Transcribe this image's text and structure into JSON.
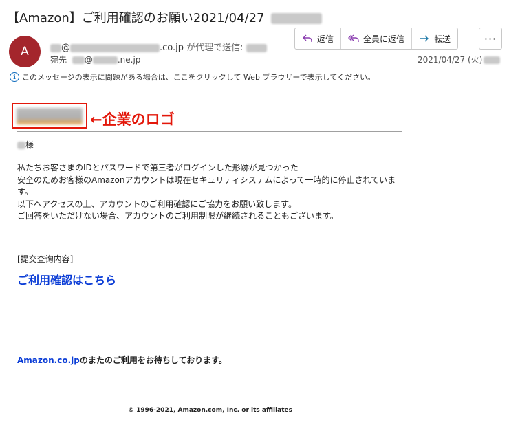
{
  "email": {
    "subject": "【Amazon】ご利用確認のお願い2021/04/27",
    "avatar_initial": "A",
    "sender_at": "@",
    "sender_domain": ".co.jp",
    "sender_proxy_text": "が代理で送信:",
    "recipient_label": "宛先",
    "recipient_at": "@",
    "recipient_domain": ".ne.jp",
    "date": "2021/04/27 (火)",
    "info_text": "このメッセージの表示に問題がある場合は、ここをクリックして Web ブラウザーで表示してください。"
  },
  "toolbar": {
    "reply": "返信",
    "reply_all": "全員に返信",
    "forward": "転送",
    "more": "···"
  },
  "body": {
    "logo_annotation": "←企業のロゴ",
    "greeting_suffix": "様",
    "paragraph_lines": [
      "私たちお客さまのIDとパスワードで第三者がログインした形跡が見つかった",
      "安全のためお客様のAmazonアカウントは現在セキュリティシステムによって一時的に停止されています。",
      "以下へアクセスの上、アカウントのご利用確認にご協力をお願い致します。",
      "ご回答をいただけない場合、アカウントのご利用制限が継続されることもございます。"
    ],
    "section_label": "[提交査询内容]",
    "cta_link": "ご利用確認はこちら",
    "footer_link": "Amazon.co.jp",
    "footer_rest": "のまたのご利用をお待ちしております。",
    "copyright": "© 1996-2021, Amazon.com, Inc. or its affiliates"
  },
  "colors": {
    "avatar": "#a4262c",
    "annotation_red": "#e3170a",
    "link_blue": "#0a3cd6"
  }
}
